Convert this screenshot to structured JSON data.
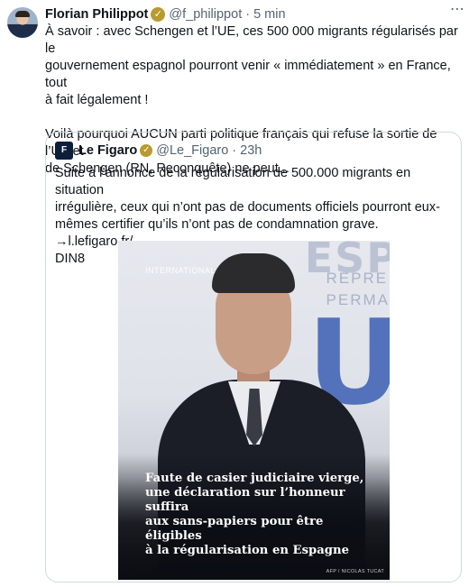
{
  "post": {
    "author_name": "Florian Philippot",
    "author_handle": "@f_philippot",
    "separator": "·",
    "time": "5 min",
    "more_icon": "⋯",
    "paragraph1_line1": "À savoir : avec Schengen et l’UE, ces 500 000 migrants régularisés par le",
    "paragraph1_line2": "gouvernement espagnol pourront venir « immédiatement » en France, tout",
    "paragraph1_line3": "à fait légalement !",
    "paragraph2_line1": "Voilà pourquoi AUCUN parti politique français qui refuse la sortie de l’UE et",
    "paragraph2_line2": "de Schengen (RN, Reconquête) ne peut..."
  },
  "quoted": {
    "author_name": "Le Figaro",
    "author_handle": "@Le_Figaro",
    "separator": "·",
    "time": "23h",
    "avatar_text": "F",
    "line1": "Suite à l’annonce de la régularisation de 500.000 migrants en situation",
    "line2": "irrégulière, ceux qui n’ont pas de documents officiels pourront eux-",
    "line3": "mêmes certifier qu’ils n’ont pas de condamnation grave. →l.lefigaro.fr/",
    "line4": "DIN8"
  },
  "media": {
    "tag": "INTERNATIONAL",
    "bg_letters": "ESP",
    "bg_rep_line1": "REPRE",
    "bg_rep_line2": "PERMA",
    "bg_u": "U",
    "caption_line1": "Faute de casier judiciaire vierge,",
    "caption_line2": "une déclaration sur l’honneur suffira",
    "caption_line3": "aux sans-papiers pour être éligibles",
    "caption_line4": "à la régularisation en Espagne",
    "credit": "AFP / NICOLAS TUCAT"
  },
  "icons": {
    "verified": "✓"
  },
  "colors": {
    "badge_gold": "#b89a2f",
    "muted": "#536471",
    "border": "#cfd9de"
  }
}
